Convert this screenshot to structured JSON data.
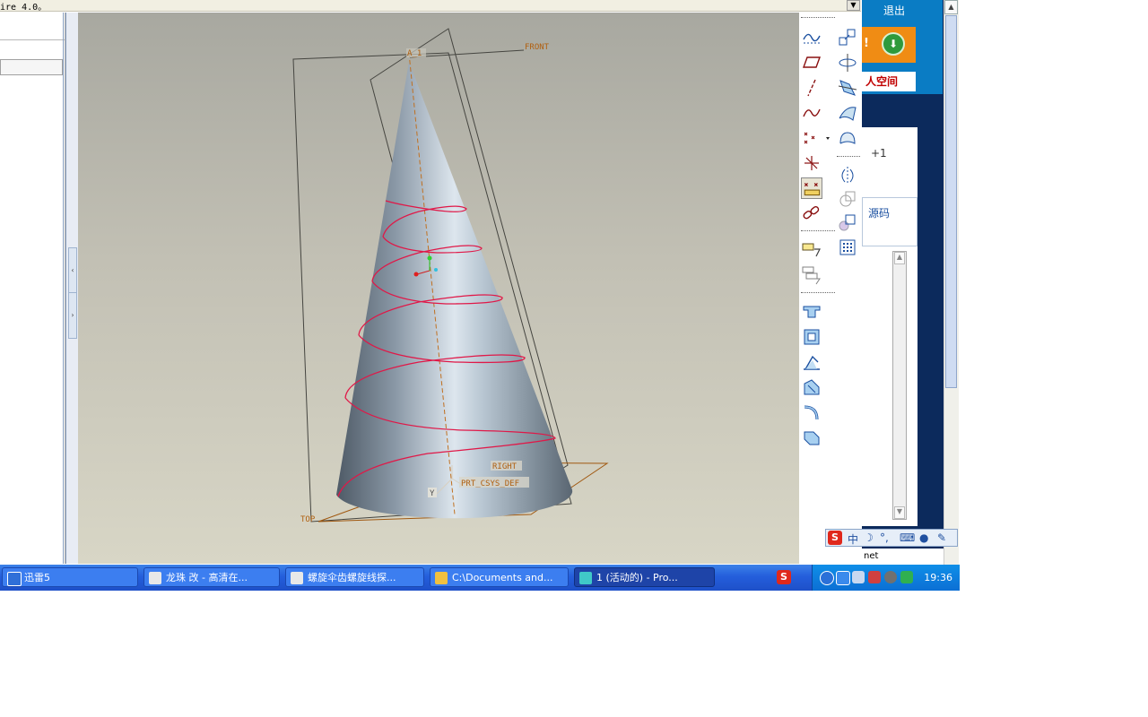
{
  "window": {
    "title_fragment": "ire 4.0。"
  },
  "datums": {
    "axis_label": "A_1",
    "front_label": "FRONT",
    "right_label": "RIGHT",
    "top_label": "TOP",
    "csys_label": "PRT_CSYS_DEF",
    "y_label": "Y",
    "x_label": "Y"
  },
  "toolbar": {
    "icons_col1": [
      "sketch-curve-icon",
      "datum-plane-icon",
      "datum-axis-icon",
      "datum-curve-icon",
      "datum-point-icon",
      "datum-csys-icon",
      "analysis-point-icon",
      "link-icon",
      "annotation-icon",
      "annotation-edit-icon",
      "extrude-cut-icon",
      "shell-icon",
      "draft-icon",
      "rib-icon",
      "round-icon",
      "chamfer-icon"
    ],
    "icons_col2": [
      "copy-icon",
      "mirror-axis-icon",
      "trim-icon",
      "surface-icon",
      "boundary-blend-icon",
      "mirror-icon",
      "merge-icon",
      "offset-icon",
      "table-icon"
    ]
  },
  "browser": {
    "exit_label": "退出",
    "space_label": "人空间",
    "plus_one": "+1",
    "source_label": "源码",
    "status_text": "net",
    "exclaim": "!"
  },
  "ime": {
    "logo": "S",
    "mode": "中"
  },
  "taskbar": {
    "tasks": [
      {
        "label": "迅雷5",
        "icon_color": "#2f6fd8",
        "active": false
      },
      {
        "label": "龙珠 改 - 高清在...",
        "icon_color": "#e8e8e8",
        "active": false
      },
      {
        "label": "螺旋伞齿螺旋线探...",
        "icon_color": "#e8e8e8",
        "active": false
      },
      {
        "label": "C:\\Documents and...",
        "icon_color": "#f0c040",
        "active": false
      },
      {
        "label": "1 (活动的) - Pro...",
        "icon_color": "#40c8c8",
        "active": true
      }
    ],
    "sogou": "S",
    "clock": "19:36"
  }
}
